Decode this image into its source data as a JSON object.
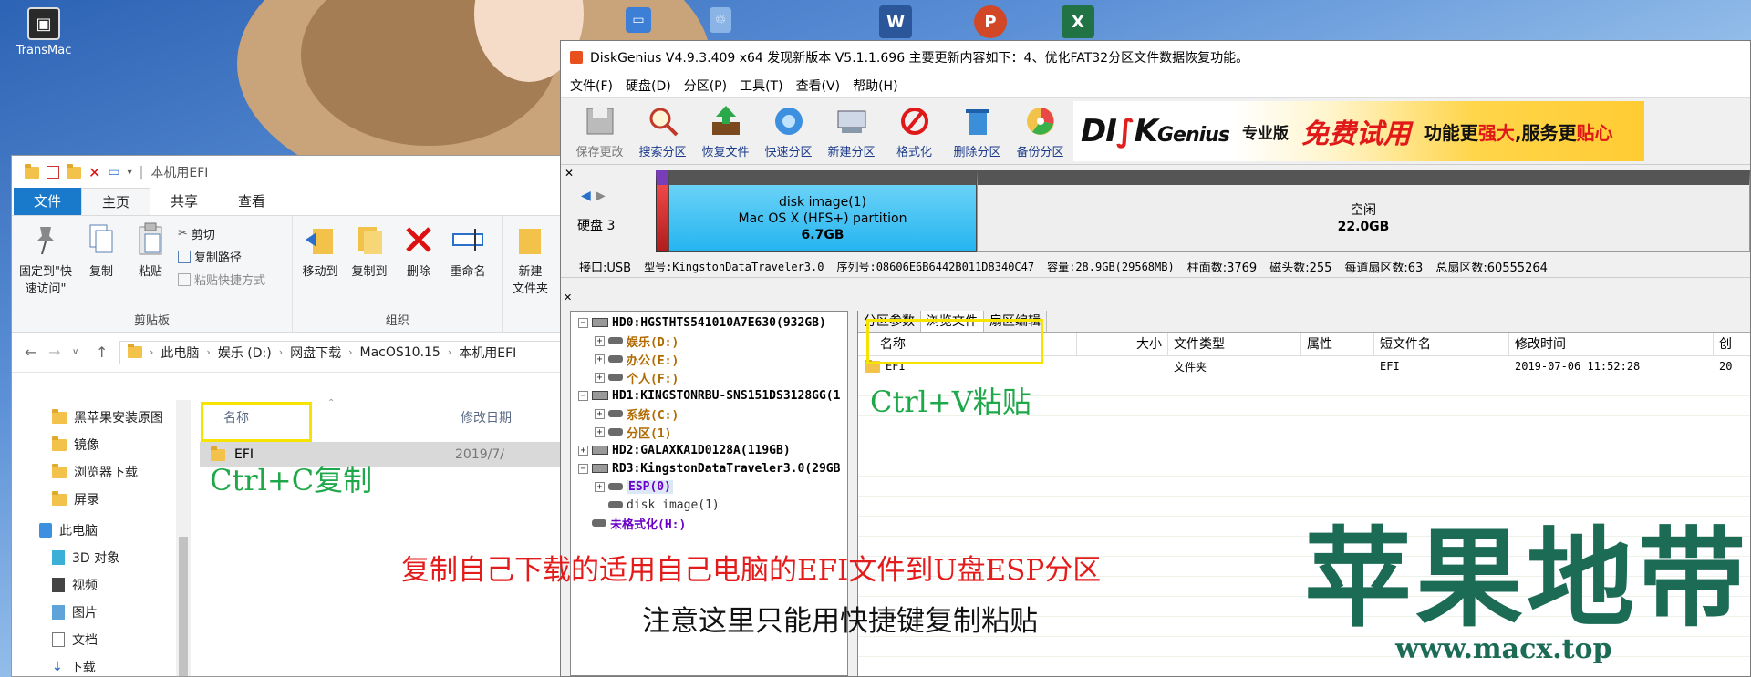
{
  "desktop": {
    "icons": [
      {
        "label": "TransMac"
      }
    ]
  },
  "explorer": {
    "title_path": "本机用EFI",
    "tabs": [
      "文件",
      "主页",
      "共享",
      "查看"
    ],
    "ribbon": {
      "clipboard": {
        "pin_label": "固定到\"快速访问\"",
        "copy_label": "复制",
        "paste_label": "粘贴",
        "cut_label": "剪切",
        "copy_path_label": "复制路径",
        "paste_shortcut_label": "粘贴快捷方式",
        "group_label": "剪贴板"
      },
      "organize": {
        "move_to_label": "移动到",
        "copy_to_label": "复制到",
        "delete_label": "删除",
        "rename_label": "重命名",
        "group_label": "组织"
      },
      "new": {
        "new_folder_label": "新建\n文件夹",
        "group_label": "新"
      }
    },
    "address": [
      "此电脑",
      "娱乐 (D:)",
      "网盘下载",
      "MacOS10.15",
      "本机用EFI"
    ],
    "nav_items": [
      {
        "label": "黑苹果安装原图",
        "icon": "folder-icon"
      },
      {
        "label": "镜像",
        "icon": "folder-icon"
      },
      {
        "label": "浏览器下载",
        "icon": "folder-icon"
      },
      {
        "label": "屏录",
        "icon": "folder-icon"
      },
      {
        "label": "此电脑",
        "icon": "computer-icon"
      },
      {
        "label": "3D 对象",
        "icon": "cube-icon"
      },
      {
        "label": "视频",
        "icon": "video-icon"
      },
      {
        "label": "图片",
        "icon": "picture-icon"
      },
      {
        "label": "文档",
        "icon": "document-icon"
      },
      {
        "label": "下载",
        "icon": "download-icon"
      },
      {
        "label": "音乐",
        "icon": "music-icon"
      }
    ],
    "columns": {
      "name": "名称",
      "modified": "修改日期"
    },
    "files": [
      {
        "name": "EFI",
        "modified": "2019/7/"
      }
    ]
  },
  "diskgenius": {
    "title": "DiskGenius V4.9.3.409 x64   发现新版本 V5.1.1.696 主要更新内容如下：4、优化FAT32分区文件数据恢复功能。",
    "menu": [
      "文件(F)",
      "硬盘(D)",
      "分区(P)",
      "工具(T)",
      "查看(V)",
      "帮助(H)"
    ],
    "toolbar": [
      {
        "label": "保存更改",
        "icon": "save-icon",
        "enabled": false
      },
      {
        "label": "搜索分区",
        "icon": "magnifier-icon",
        "enabled": true
      },
      {
        "label": "恢复文件",
        "icon": "recover-icon",
        "enabled": true
      },
      {
        "label": "快速分区",
        "icon": "quick-partition-icon",
        "enabled": true
      },
      {
        "label": "新建分区",
        "icon": "new-partition-icon",
        "enabled": true
      },
      {
        "label": "格式化",
        "icon": "format-icon",
        "enabled": true
      },
      {
        "label": "删除分区",
        "icon": "trash-icon",
        "enabled": true
      },
      {
        "label": "备份分区",
        "icon": "backup-icon",
        "enabled": true
      }
    ],
    "banner": {
      "logo_a": "DI",
      "logo_b": "K",
      "logo_c": "Genius",
      "edition": "专业版",
      "trial": "免费试用",
      "slogan_a": "功能更",
      "slogan_b": "强大",
      "slogan_c": ",服务更",
      "slogan_d": "贴心"
    },
    "disk_map": {
      "disk_label": "硬盘 3",
      "partition": {
        "name": "disk image(1)",
        "fs": "Mac OS X (HFS+) partition",
        "size": "6.7GB"
      },
      "free": {
        "name": "空闲",
        "size": "22.0GB"
      }
    },
    "disk_info": {
      "interface": "接口:USB",
      "model": "型号:KingstonDataTraveler3.0",
      "serial": "序列号:08606E6B6442B011D8340C47",
      "capacity": "容量:28.9GB(29568MB)",
      "cylinders": "柱面数:3769",
      "heads": "磁头数:255",
      "sectors_per_track": "每道扇区数:63",
      "total_sectors": "总扇区数:60555264"
    },
    "tree": [
      {
        "label": "HD0:HGSTHTS541010A7E630(932GB)",
        "level": 0,
        "kind": "disk",
        "color": "t-gray-bold",
        "expander": "−"
      },
      {
        "label": "娱乐(D:)",
        "level": 1,
        "kind": "part",
        "color": "t-orange",
        "expander": "+"
      },
      {
        "label": "办公(E:)",
        "level": 1,
        "kind": "part",
        "color": "t-orange",
        "expander": "+"
      },
      {
        "label": "个人(F:)",
        "level": 1,
        "kind": "part",
        "color": "t-orange",
        "expander": "+"
      },
      {
        "label": "HD1:KINGSTONRBU-SNS151DS3128GG(1",
        "level": 0,
        "kind": "disk",
        "color": "t-gray-bold",
        "expander": "−"
      },
      {
        "label": "系统(C:)",
        "level": 1,
        "kind": "part",
        "color": "t-orange",
        "expander": "+"
      },
      {
        "label": "分区(1)",
        "level": 1,
        "kind": "part",
        "color": "t-orange",
        "expander": "+"
      },
      {
        "label": "HD2:GALAXKA1D0128A(119GB)",
        "level": 0,
        "kind": "disk",
        "color": "t-gray-bold",
        "expander": "+"
      },
      {
        "label": "RD3:KingstonDataTraveler3.0(29GB",
        "level": 0,
        "kind": "disk",
        "color": "t-gray-bold",
        "expander": "−"
      },
      {
        "label": "ESP(0)",
        "level": 1,
        "kind": "part",
        "color": "t-purple",
        "expander": "+",
        "selected": true
      },
      {
        "label": "disk image(1)",
        "level": 1,
        "kind": "part",
        "color": "t-gray",
        "expander": ""
      },
      {
        "label": "未格式化(H:)",
        "level": 0,
        "kind": "part",
        "color": "t-purple",
        "expander": ""
      }
    ],
    "tabs": [
      "分区参数",
      "浏览文件",
      "扇区编辑"
    ],
    "columns": [
      "名称",
      "大小",
      "文件类型",
      "属性",
      "短文件名",
      "修改时间",
      "创"
    ],
    "files": [
      {
        "name": "EFI",
        "size": "",
        "type": "文件夹",
        "attr": "",
        "short": "EFI",
        "modified": "2019-07-06 11:52:28",
        "created": "20"
      }
    ]
  },
  "annotations": {
    "copy_hint": "Ctrl+C复制",
    "paste_hint": "Ctrl+V粘贴",
    "instruction_red": "复制自己下载的适用自己电脑的EFI文件到U盘ESP分区",
    "instruction_black": "注意这里只能用快捷键复制粘贴"
  },
  "watermark": {
    "title": "苹果地带",
    "url": "www.macx.top"
  },
  "colors": {
    "hint_green": "#1ea84a",
    "hint_red": "#e31b1b",
    "highlight_yellow": "#f5e400",
    "watermark": "#1b6b55",
    "ribbon_file_tab": "#1979ca"
  }
}
